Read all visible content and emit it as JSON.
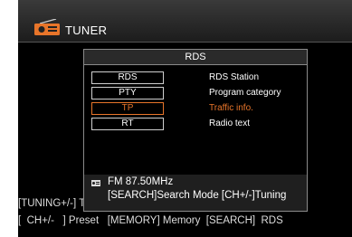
{
  "header": {
    "title": "TUNER",
    "icon": "radio-icon"
  },
  "dialog": {
    "title": "RDS",
    "items": [
      {
        "key": "RDS",
        "description": "RDS Station",
        "selected": false
      },
      {
        "key": "PTY",
        "description": "Program category",
        "selected": false
      },
      {
        "key": "TP",
        "description": "Traffic info.",
        "selected": true
      },
      {
        "key": "RT",
        "description": "Radio text",
        "selected": false
      }
    ],
    "info": {
      "freq": "FM  87.50MHz",
      "help": "[SEARCH]Search Mode [CH+/-]Tuning"
    }
  },
  "bottom": {
    "line1": "[TUNING+/-] Tuning   [ BAND ] Band     [ MODE ] Mode",
    "line2": "[  CH+/-   ] Preset   [MEMORY] Memory  [SEARCH]  RDS"
  },
  "colors": {
    "accent": "#e8752a",
    "background": "#000000",
    "text": "#ffffff"
  }
}
